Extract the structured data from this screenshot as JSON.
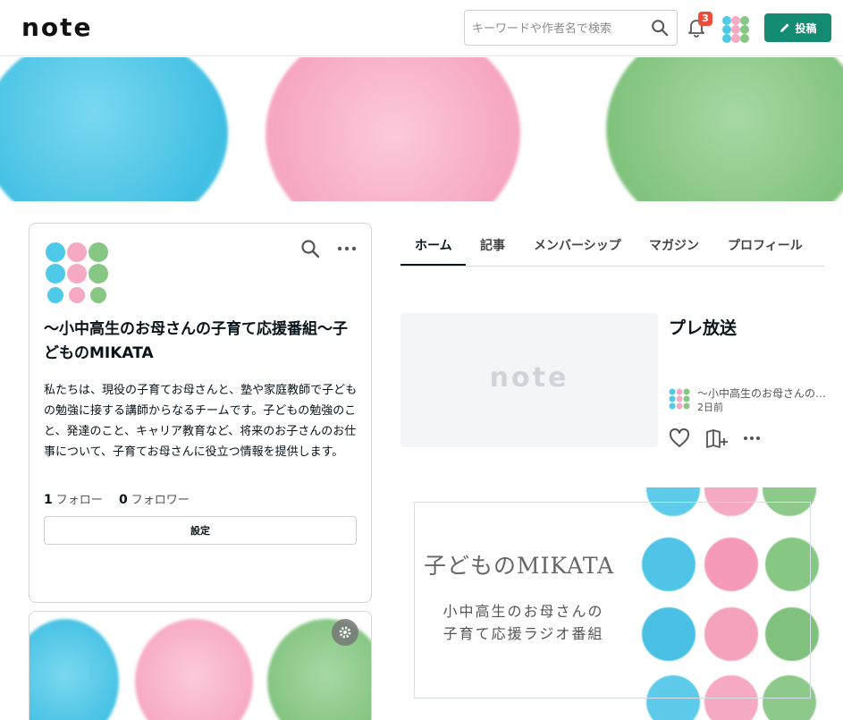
{
  "header": {
    "logo": "note",
    "search_placeholder": "キーワードや作者名で検索",
    "notification_count": "3",
    "post_label": "投稿",
    "icons": {
      "search": "search-icon",
      "bell": "bell-icon",
      "pencil": "pencil-icon"
    }
  },
  "profile": {
    "title": "〜小中高生のお母さんの子育て応援番組〜子どものMIKATA",
    "description": "私たちは、現役の子育てお母さんと、塾や家庭教師で子どもの勉強に接する講師からなるチームです。子どもの勉強のこと、発達のこと、キャリア教育など、将来のお子さんのお仕事について、子育てお母さんに役立つ情報を提供します。",
    "follow_count": "1",
    "follow_label": "フォロー",
    "follower_count": "0",
    "follower_label": "フォロワー",
    "setting_label": "設定"
  },
  "tabs": [
    {
      "label": "ホーム",
      "active": true
    },
    {
      "label": "記事",
      "active": false
    },
    {
      "label": "メンバーシップ",
      "active": false
    },
    {
      "label": "マガジン",
      "active": false
    },
    {
      "label": "プロフィール",
      "active": false
    }
  ],
  "article": {
    "thumb_logo": "note",
    "title": "プレ放送",
    "author": "〜小中高生のお母さんの子育て応援番組〜子どものMIKATA",
    "time": "2日前"
  },
  "promo": {
    "title": "子どものMIKATA",
    "subtitle_line1": "小中高生のお母さんの",
    "subtitle_line2": "子育て応援ラジオ番組"
  },
  "colors": {
    "accent": "#138a72",
    "badge": "#e94e3c",
    "blue": "#4fc9e8",
    "pink": "#f5a9c2",
    "green": "#86c784"
  }
}
